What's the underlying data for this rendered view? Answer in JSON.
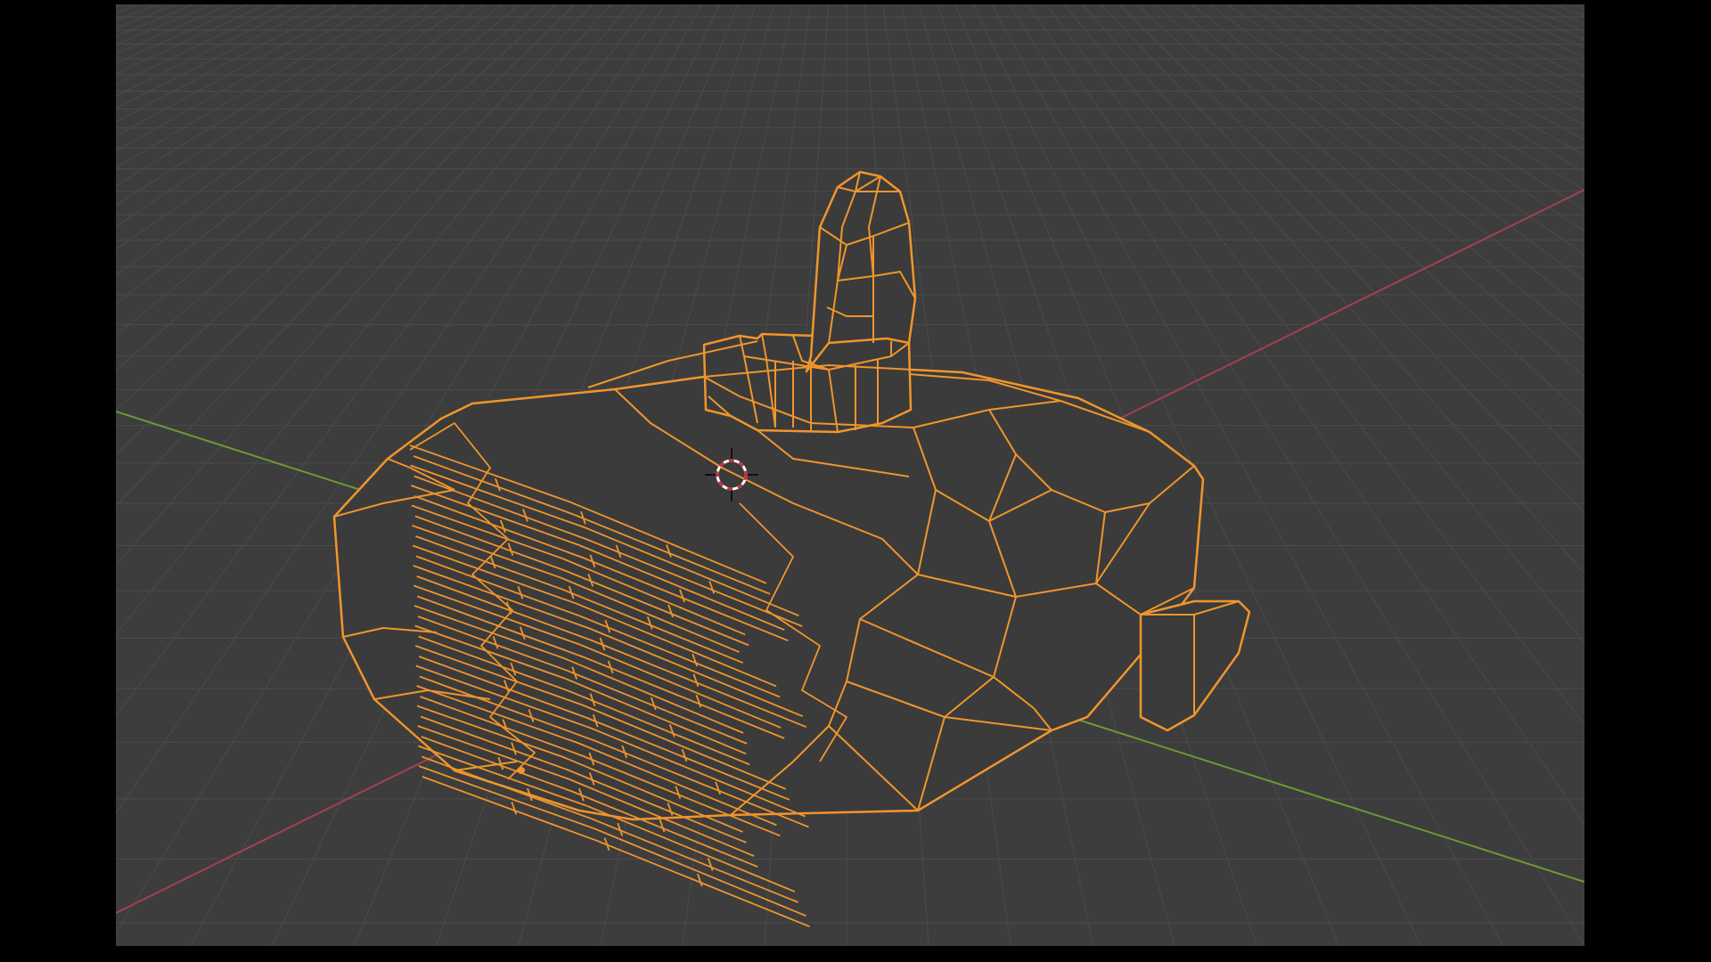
{
  "app": "3D viewport",
  "viewport": {
    "background_color": "#3d3d3d",
    "grid_color": "#4b4b4b",
    "x_axis_color": "#a4404f",
    "y_axis_color": "#6e9a33"
  },
  "selection": {
    "outline_color": "#f0952c",
    "face_color": "#3b3b3b",
    "mode": "wireframe",
    "selected": true
  },
  "cursor_3d": {
    "icon": "3d-cursor-icon"
  },
  "origin": {
    "icon": "origin-dot-icon"
  }
}
